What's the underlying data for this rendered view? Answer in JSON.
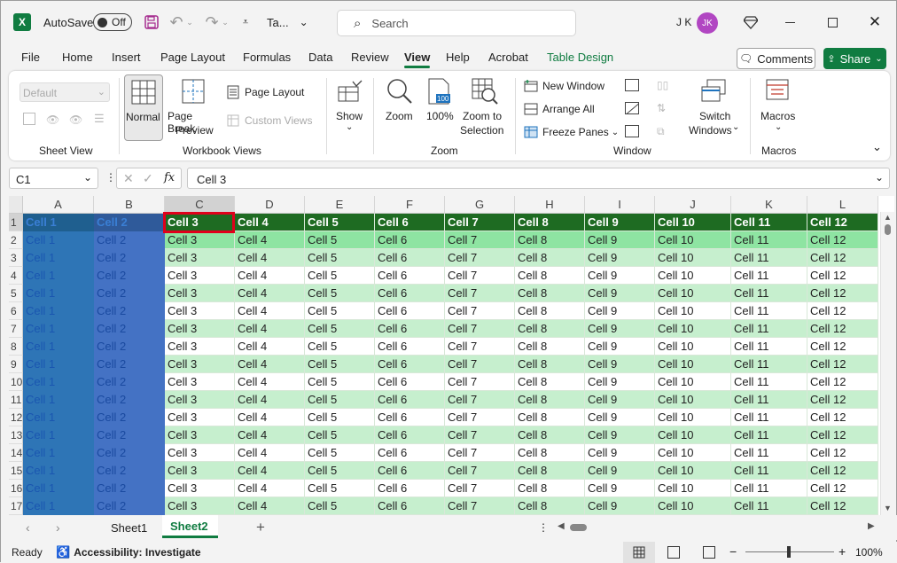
{
  "titlebar": {
    "autosave_label": "AutoSave",
    "autosave_state": "Off",
    "file_name": "Ta...",
    "search_placeholder": "Search",
    "user_initials_text": "J K",
    "avatar_initials": "JK"
  },
  "ribbon_tabs": [
    "File",
    "Home",
    "Insert",
    "Page Layout",
    "Formulas",
    "Data",
    "Review",
    "View",
    "Help",
    "Acrobat",
    "Table Design"
  ],
  "ribbon": {
    "sheet_view_default": "Default",
    "sheet_view_group": "Sheet View",
    "normal": "Normal",
    "page_break_1": "Page Break",
    "page_break_2": "Preview",
    "page_layout": "Page Layout",
    "custom_views": "Custom Views",
    "workbook_views_group": "Workbook Views",
    "show": "Show",
    "zoom": "Zoom",
    "zoom100": "100%",
    "zoom_sel_1": "Zoom to",
    "zoom_sel_2": "Selection",
    "zoom_group": "Zoom",
    "new_window": "New Window",
    "arrange_all": "Arrange All",
    "freeze_panes": "Freeze Panes",
    "switch_1": "Switch",
    "switch_2": "Windows",
    "window_group": "Window",
    "macros": "Macros",
    "macros_group": "Macros",
    "comments": "Comments",
    "share": "Share"
  },
  "formula_bar": {
    "name_box": "C1",
    "fx": "fx",
    "content": "Cell 3"
  },
  "grid": {
    "columns": [
      "A",
      "B",
      "C",
      "D",
      "E",
      "F",
      "G",
      "H",
      "I",
      "J",
      "K",
      "L"
    ],
    "rows": [
      "1",
      "2",
      "3",
      "4",
      "5",
      "6",
      "7",
      "8",
      "9",
      "10",
      "11",
      "12",
      "13",
      "14",
      "15",
      "16",
      "17"
    ],
    "header_row": [
      "Cell 1",
      "Cell 2",
      "Cell 3",
      "Cell 4",
      "Cell 5",
      "Cell 6",
      "Cell 7",
      "Cell 8",
      "Cell 9",
      "Cell 10",
      "Cell 11",
      "Cell 12"
    ],
    "data_row": [
      "Cell 1",
      "Cell 2",
      "Cell 3",
      "Cell 4",
      "Cell 5",
      "Cell 6",
      "Cell 7",
      "Cell 8",
      "Cell 9",
      "Cell 10",
      "Cell 11",
      "Cell 12"
    ],
    "selected_cell": "C1"
  },
  "sheets": [
    "Sheet1",
    "Sheet2"
  ],
  "active_sheet": "Sheet2",
  "status": {
    "ready": "Ready",
    "accessibility": "Accessibility: Investigate",
    "zoom": "100%"
  },
  "colors": {
    "excel_green": "#107c41",
    "header_green": "#1e6b22",
    "band_green": "#c6efce",
    "band_green_dark": "#8ee4a2",
    "col_a_blue": "#2e75b6",
    "col_b_blue": "#4472c4",
    "selection_red": "#e0001b",
    "avatar": "#b146c2"
  }
}
